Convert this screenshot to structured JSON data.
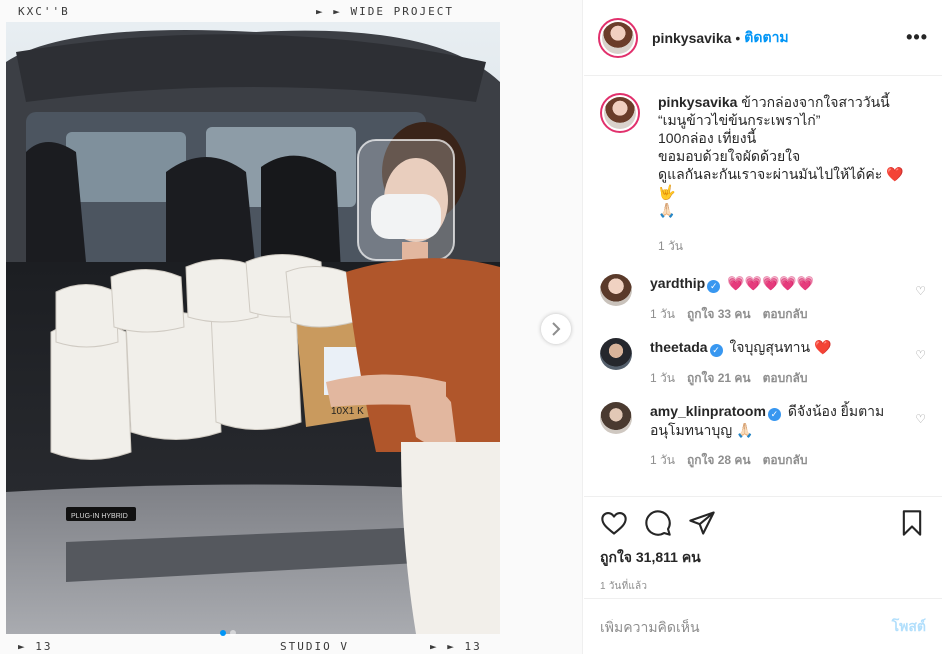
{
  "photo": {
    "film_top_left": "KXC''B",
    "film_top_right": "► ► WIDE PROJECT",
    "film_bottom_left": "► 13",
    "film_bottom_center": "STUDIO V",
    "film_bottom_right": "► ► 13",
    "car_badge": "PLUG-IN HYBRID",
    "box_label": "10X1 K",
    "next_icon": "chevron-right-icon"
  },
  "header": {
    "username": "pinkysavika",
    "separator": "•",
    "follow_label": "ติดตาม",
    "more_label": "•••"
  },
  "caption": {
    "username": "pinkysavika",
    "text": "ข้าวกล่องจากใจสาววันนี้\n“เมนูข้าวไข่ข้นกระเพราไก่”\n100กล่อง เที่ยงนี้\nขอมอบด้วยใจผัดด้วยใจ\nดูแลกันละกันเราจะผ่านมันไปให้ได้ค่ะ ❤️🤟\n🙏🏻",
    "time": "1 วัน"
  },
  "comments": [
    {
      "username": "yardthip",
      "verified": true,
      "text": "💗💗💗💗💗",
      "time": "1 วัน",
      "likes": "ถูกใจ 33 คน",
      "reply": "ตอบกลับ",
      "avatar_color": "#b98a6e"
    },
    {
      "username": "theetada",
      "verified": true,
      "text": "ใจบุญสุนทาน ❤️",
      "time": "1 วัน",
      "likes": "ถูกใจ 21 คน",
      "reply": "ตอบกลับ",
      "avatar_color": "#3b3f4a"
    },
    {
      "username": "amy_klinpratoom",
      "verified": true,
      "text": "ดีจังน้อง ยิ้มตาม\nอนุโมทนาบุญ 🙏🏻",
      "time": "1 วัน",
      "likes": "ถูกใจ 28 คน",
      "reply": "ตอบกลับ",
      "avatar_color": "#8a7f74"
    }
  ],
  "actions": {
    "likes": "ถูกใจ 31,811 คน",
    "posted": "1 วันที่แล้ว"
  },
  "add_comment": {
    "placeholder": "เพิ่มความคิดเห็น",
    "post_label": "โพสต์"
  }
}
